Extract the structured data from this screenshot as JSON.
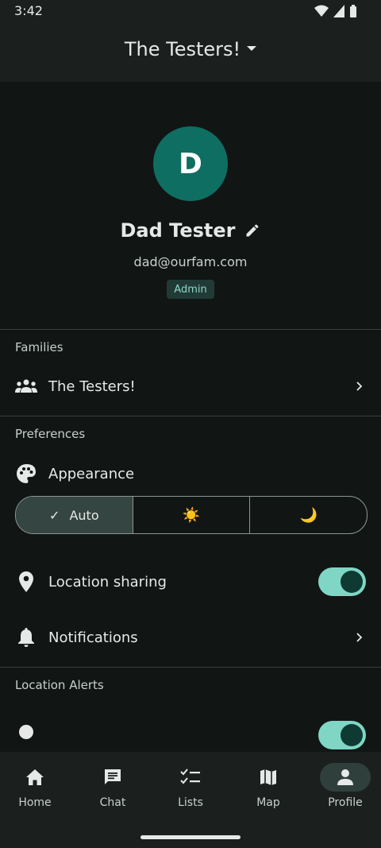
{
  "status_bar": {
    "time": "3:42"
  },
  "app_bar": {
    "title": "The Testers!"
  },
  "profile": {
    "avatar_initial": "D",
    "name": "Dad Tester",
    "email": "dad@ourfam.com",
    "role": "Admin"
  },
  "families": {
    "header": "Families",
    "items": [
      {
        "label": "The Testers!"
      }
    ]
  },
  "preferences": {
    "header": "Preferences",
    "appearance": {
      "label": "Appearance",
      "options": [
        {
          "label": "Auto",
          "check": "✓",
          "selected": true
        },
        {
          "label": "",
          "glyph": "☀️",
          "icon": "sun-icon"
        },
        {
          "label": "",
          "glyph": "🌙",
          "icon": "moon-icon"
        }
      ]
    },
    "location_sharing": {
      "label": "Location sharing",
      "enabled": true
    },
    "notifications": {
      "label": "Notifications"
    }
  },
  "location_alerts": {
    "header": "Location Alerts"
  },
  "bottom_nav": {
    "items": [
      {
        "label": "Home",
        "icon": "home-icon"
      },
      {
        "label": "Chat",
        "icon": "chat-icon"
      },
      {
        "label": "Lists",
        "icon": "checklist-icon"
      },
      {
        "label": "Map",
        "icon": "map-icon"
      },
      {
        "label": "Profile",
        "icon": "person-icon",
        "active": true
      }
    ]
  },
  "colors": {
    "accent": "#7fd6c4",
    "avatar_bg": "#0f6e62",
    "background": "#111615",
    "surface": "#1b201f"
  }
}
